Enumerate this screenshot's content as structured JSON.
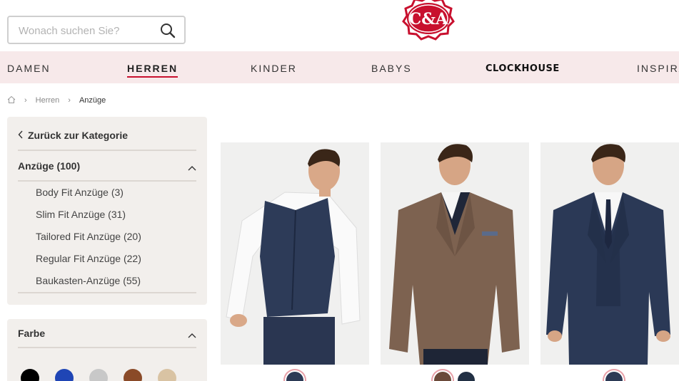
{
  "search": {
    "placeholder": "Wonach suchen Sie?"
  },
  "logo": {
    "text": "C&A",
    "color": "#c8102e"
  },
  "nav": {
    "items": [
      "DAMEN",
      "HERREN",
      "KINDER",
      "BABYS",
      "CLOCKHOUSE",
      "INSPIRA"
    ],
    "active": "HERREN",
    "background": "#f7e9ea"
  },
  "breadcrumb": {
    "items": [
      "Herren",
      "Anzüge"
    ]
  },
  "sidebar": {
    "back_label": "Zurück zur Kategorie",
    "category": {
      "title": "Anzüge (100)",
      "items": [
        "Body Fit Anzüge (3)",
        "Slim Fit Anzüge (31)",
        "Tailored Fit Anzüge (20)",
        "Regular Fit Anzüge (22)",
        "Baukasten-Anzüge (55)"
      ]
    },
    "color_filter": {
      "title": "Farbe",
      "swatches": [
        "#000000",
        "#1f45b5",
        "#c8c8c8",
        "#8a4a28",
        "#d9c3a3"
      ]
    }
  },
  "products": [
    {
      "name": "navy waistcoat suit",
      "colors": [
        "#2c3a55"
      ]
    },
    {
      "name": "brown corduroy jacket",
      "colors": [
        "#6b4a3a",
        "#223044"
      ]
    },
    {
      "name": "navy three-piece suit",
      "colors": [
        "#2c3a55"
      ]
    }
  ],
  "colors": {
    "accent": "#c8102e",
    "panel": "#f2efec"
  }
}
